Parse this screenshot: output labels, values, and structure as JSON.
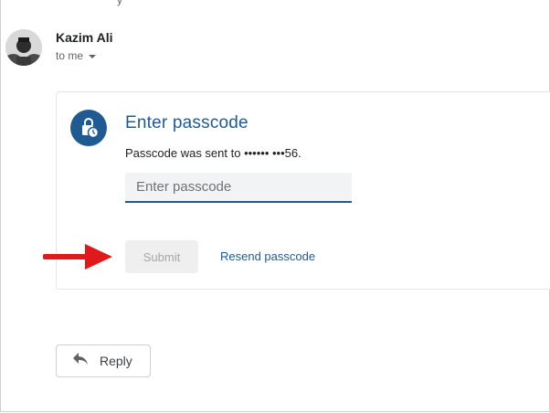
{
  "email": {
    "cut_off_text": "y",
    "sender": "Kazim Ali",
    "recipient": "to me"
  },
  "passcode_card": {
    "title": "Enter passcode",
    "sent_to": "Passcode was sent to •••••• •••56.",
    "input_placeholder": "Enter passcode",
    "input_value": "",
    "submit_label": "Submit",
    "resend_label": "Resend passcode"
  },
  "reply": {
    "label": "Reply"
  },
  "icons": {
    "avatar": "avatar",
    "card_badge": "lock-clock-icon",
    "reply": "reply-icon",
    "recipient_dropdown": "caret-down-icon",
    "annotation": "red-arrow-icon"
  },
  "colors": {
    "accent": "#1f5a93",
    "arrow": "#e0191b",
    "disabled_button_bg": "#efefef",
    "disabled_button_text": "#a6a6a6"
  }
}
